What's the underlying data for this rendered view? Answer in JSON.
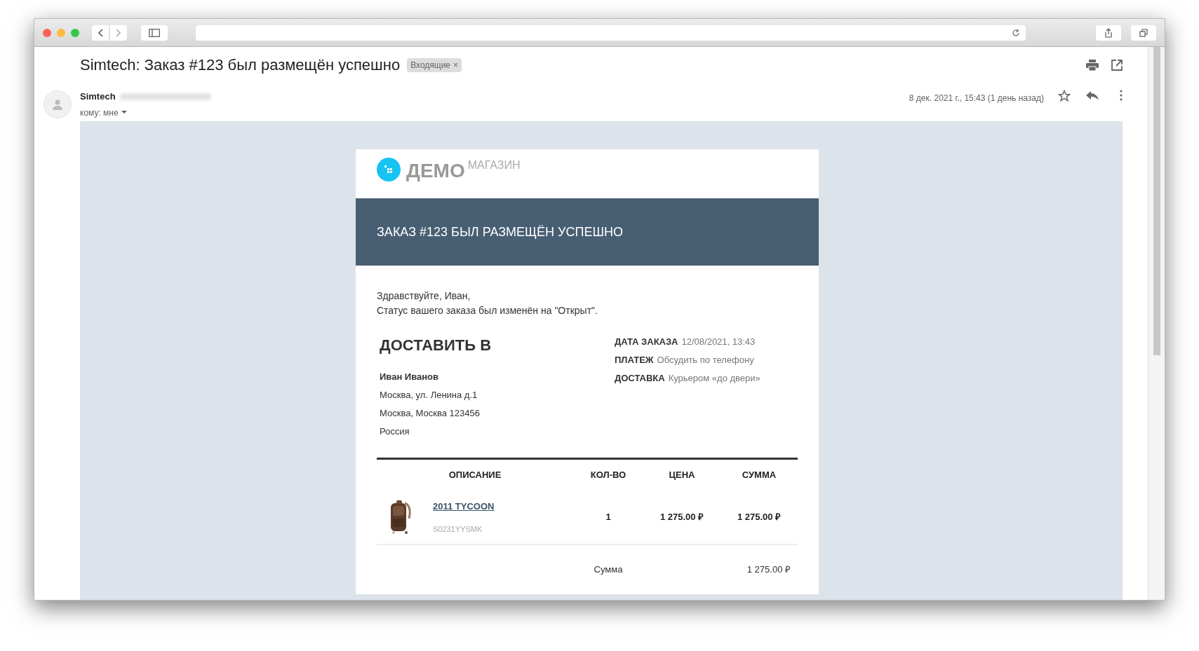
{
  "email": {
    "subject": "Simtech: Заказ #123 был размещён успешно",
    "label": {
      "text": "Входящие",
      "close": "×"
    },
    "sender": "Simtech",
    "to": "кому: мне",
    "date": "8 дек. 2021 г., 15:43 (1 день назад)",
    "starred": false
  },
  "message": {
    "logo": {
      "main": "ДЕМО",
      "sub": "МАГАЗИН"
    },
    "banner": "ЗАКАЗ #123 БЫЛ РАЗМЕЩЁН УСПЕШНО",
    "greeting": "Здравствуйте, Иван,",
    "status_line": "Статус вашего заказа был изменён на \"Открыт\".",
    "ship_to": {
      "title": "ДОСТАВИТЬ В",
      "name": "Иван Иванов",
      "lines": [
        "Москва, ул. Ленина д.1",
        "Москва, Москва 123456",
        "Россия"
      ]
    },
    "order_info": [
      {
        "label": "ДАТА ЗАКАЗА",
        "value": "12/08/2021, 13:43"
      },
      {
        "label": "ПЛАТЕЖ",
        "value": "Обсудить по телефону"
      },
      {
        "label": "ДОСТАВКА",
        "value": "Курьером «до двери»"
      }
    ],
    "table": {
      "columns": [
        "ОПИСАНИЕ",
        "КОЛ-ВО",
        "ЦЕНА",
        "СУММА"
      ],
      "rows": [
        {
          "kind": "picture",
          "name": "2011 TYCOON",
          "sku": "S0231YYSMK",
          "qty": "1",
          "price": "1 275.00 ₽",
          "total": "1 275.00 ₽"
        }
      ]
    },
    "summary": {
      "label": "Сумма",
      "value": "1 275.00 ₽"
    }
  }
}
